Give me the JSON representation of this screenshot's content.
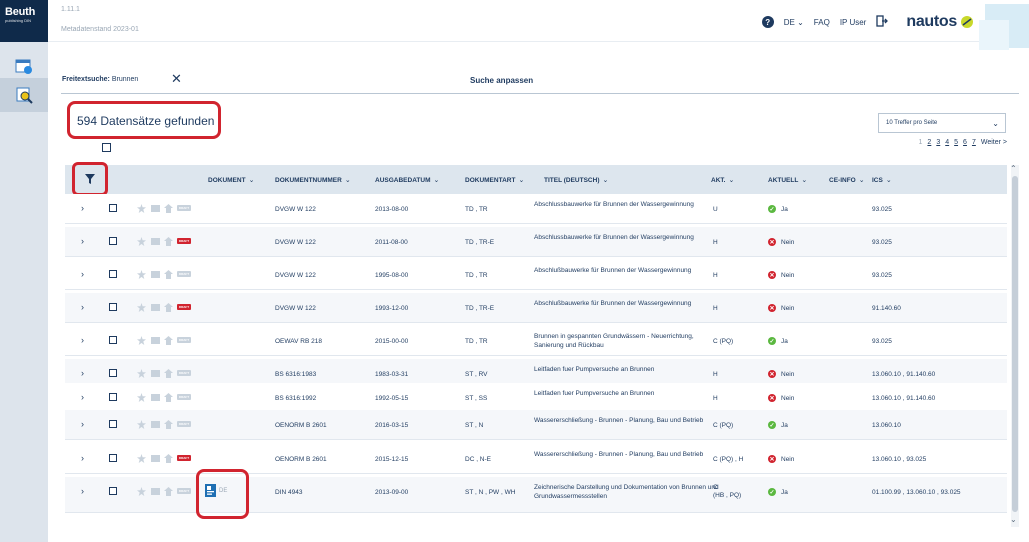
{
  "app": {
    "logo": "Beuth",
    "logo_sub": "publishing DIN",
    "version": "1.11.1",
    "metadata": "Metadatenstand 2023-01"
  },
  "header": {
    "language": "DE",
    "faq": "FAQ",
    "user": "IP User",
    "brand": "nautos"
  },
  "search": {
    "label": "Freitextsuche:",
    "value": "Brunnen",
    "adjust": "Suche anpassen"
  },
  "results": {
    "count_text": "594 Datensätze gefunden",
    "per_page": "10 Treffer pro Seite",
    "pages": [
      "1",
      "2",
      "3",
      "4",
      "5",
      "6",
      "7"
    ],
    "next": "Weiter >"
  },
  "columns": {
    "dokument": "DOKUMENT",
    "nummer": "DOKUMENTNUMMER",
    "datum": "AUSGABEDATUM",
    "art": "DOKUMENTART",
    "titel": "TITEL (DEUTSCH)",
    "akt": "AKT.",
    "aktuell": "AKTUELL",
    "ceinfo": "CE-INFO",
    "ics": "ICS"
  },
  "draft_label": "DRAFT",
  "rows": [
    {
      "nummer": "DVGW W 122",
      "datum": "2013-08-00",
      "art": "TD , TR",
      "titel": "Abschlussbauwerke für Brunnen der Wassergewinnung",
      "akt": "U",
      "aktuell": "Ja",
      "ics": "93.025"
    },
    {
      "nummer": "DVGW W 122",
      "datum": "2011-08-00",
      "art": "TD , TR-E",
      "titel": "Abschlussbauwerke für Brunnen der Wassergewinnung",
      "akt": "H",
      "aktuell": "Nein",
      "ics": "93.025"
    },
    {
      "nummer": "DVGW W 122",
      "datum": "1995-08-00",
      "art": "TD , TR",
      "titel": "Abschlußbauwerke für Brunnen der Wassergewinnung",
      "akt": "H",
      "aktuell": "Nein",
      "ics": "93.025"
    },
    {
      "nummer": "DVGW W 122",
      "datum": "1993-12-00",
      "art": "TD , TR-E",
      "titel": "Abschlußbauwerke für Brunnen der Wassergewinnung",
      "akt": "H",
      "aktuell": "Nein",
      "ics": "91.140.60"
    },
    {
      "nummer": "OEWAV RB 218",
      "datum": "2015-00-00",
      "art": "TD , TR",
      "titel": "Brunnen in gespannten Grundwässern - Neuerrichtung, Sanierung und Rückbau",
      "akt": "C (PQ)",
      "aktuell": "Ja",
      "ics": "93.025"
    },
    {
      "nummer": "BS 6316:1983",
      "datum": "1983-03-31",
      "art": "ST , RV",
      "titel": "Leitfaden fuer Pumpversuche an Brunnen",
      "akt": "H",
      "aktuell": "Nein",
      "ics": "13.060.10 , 91.140.60"
    },
    {
      "nummer": "BS 6316:1992",
      "datum": "1992-05-15",
      "art": "ST , SS",
      "titel": "Leitfaden fuer Pumpversuche an Brunnen",
      "akt": "H",
      "aktuell": "Nein",
      "ics": "13.060.10 , 91.140.60"
    },
    {
      "nummer": "OENORM B 2601",
      "datum": "2016-03-15",
      "art": "ST , N",
      "titel": "Wassererschließung - Brunnen - Planung, Bau und Betrieb",
      "akt": "C (PQ)",
      "aktuell": "Ja",
      "ics": "13.060.10"
    },
    {
      "nummer": "OENORM B 2601",
      "datum": "2015-12-15",
      "art": "DC , N-E",
      "titel": "Wassererschließung - Brunnen - Planung, Bau und Betrieb",
      "akt": "C (PQ) , H",
      "aktuell": "Nein",
      "ics": "13.060.10 , 93.025"
    },
    {
      "nummer": "DIN 4943",
      "datum": "2013-09-00",
      "art": "ST , N , PW , WH",
      "titel": "Zeichnerische Darstellung und Dokumentation von Brunnen und Grundwassermessstellen",
      "akt_line1": "C",
      "akt_line2": "(HB , PQ)",
      "aktuell": "Ja",
      "ics": "01.100.99 , 13.060.10 , 93.025"
    }
  ],
  "row10_doc_lang": "DE",
  "colors": {
    "navy": "#1e3a5f",
    "highlight": "#d1242f",
    "ok": "#5bb840",
    "header_bg": "#dde6ee"
  }
}
